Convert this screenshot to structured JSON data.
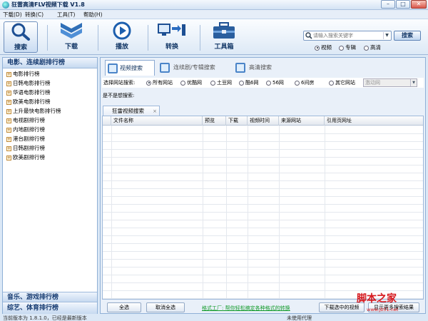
{
  "window": {
    "title": "狂雷高清FLV视频下载 V1.8",
    "min_label": "–",
    "max_label": "□",
    "close_label": "✕"
  },
  "menu": [
    {
      "label": "下载(D)"
    },
    {
      "label": "转换(C)"
    },
    {
      "label": "工具(T)"
    },
    {
      "label": "帮助(H)"
    }
  ],
  "toolbar": {
    "tools": [
      {
        "label": "搜索",
        "icon": "search-icon"
      },
      {
        "label": "下载",
        "icon": "download-icon"
      },
      {
        "label": "播放",
        "icon": "play-icon"
      },
      {
        "label": "转换",
        "icon": "convert-icon"
      },
      {
        "label": "工具箱",
        "icon": "toolbox-icon"
      }
    ]
  },
  "search": {
    "placeholder": "请输入搜索关键字",
    "button_label": "搜索",
    "types": [
      {
        "label": "视频",
        "checked": true
      },
      {
        "label": "专辑",
        "checked": false
      },
      {
        "label": "高清",
        "checked": false
      }
    ]
  },
  "sidebar": {
    "sections": [
      {
        "title": "电影、连续剧排行榜"
      },
      {
        "title": "音乐、游戏排行榜"
      },
      {
        "title": "综艺、体育排行榜"
      }
    ],
    "items": [
      "电影排行榜",
      "日韩电影排行榜",
      "华语电影排行榜",
      "欧美电影排行榜",
      "上升最快电影排行榜",
      "电视剧排行榜",
      "内地剧排行榜",
      "港台剧排行榜",
      "日韩剧排行榜",
      "欧美剧排行榜"
    ]
  },
  "main": {
    "tabs": [
      {
        "label": "视频搜索",
        "active": true
      },
      {
        "label": "连续剧/专辑搜索",
        "active": false
      },
      {
        "label": "高清搜索",
        "active": false
      }
    ],
    "filter": {
      "label": "选择网站搜索:",
      "options": [
        {
          "label": "所有网站",
          "checked": true
        },
        {
          "label": "优酷网",
          "checked": false
        },
        {
          "label": "土豆网",
          "checked": false
        },
        {
          "label": "酷6网",
          "checked": false
        },
        {
          "label": "56网",
          "checked": false
        },
        {
          "label": "6间房",
          "checked": false
        },
        {
          "label": "其它网站",
          "checked": false
        }
      ],
      "select_value": "激动网"
    },
    "wish_text": "是不是想搜索:",
    "result_tab": {
      "label": "狂雷视频搜索",
      "close": "×"
    },
    "columns": [
      "文件名称",
      "预览",
      "下载",
      "视频时间",
      "来源网站",
      "引用页网址"
    ],
    "buttons": {
      "select_all": "全选",
      "deselect_all": "取消全选",
      "download_selected": "下载选中的视频",
      "show_more": "显示更多搜索结果"
    },
    "promo_link": "格式工厂: 帮你轻松搞定各种格式的转换"
  },
  "status": {
    "version_text": "当前版本为 1.8.1.0，已经是最新版本",
    "proxy_text": "未使用代理"
  },
  "watermark": {
    "big": "脚本之家",
    "small": "www.jb51.net"
  },
  "colors": {
    "accent": "#153a70",
    "link_green": "#119a2a",
    "watermark_red": "#d6181d"
  }
}
